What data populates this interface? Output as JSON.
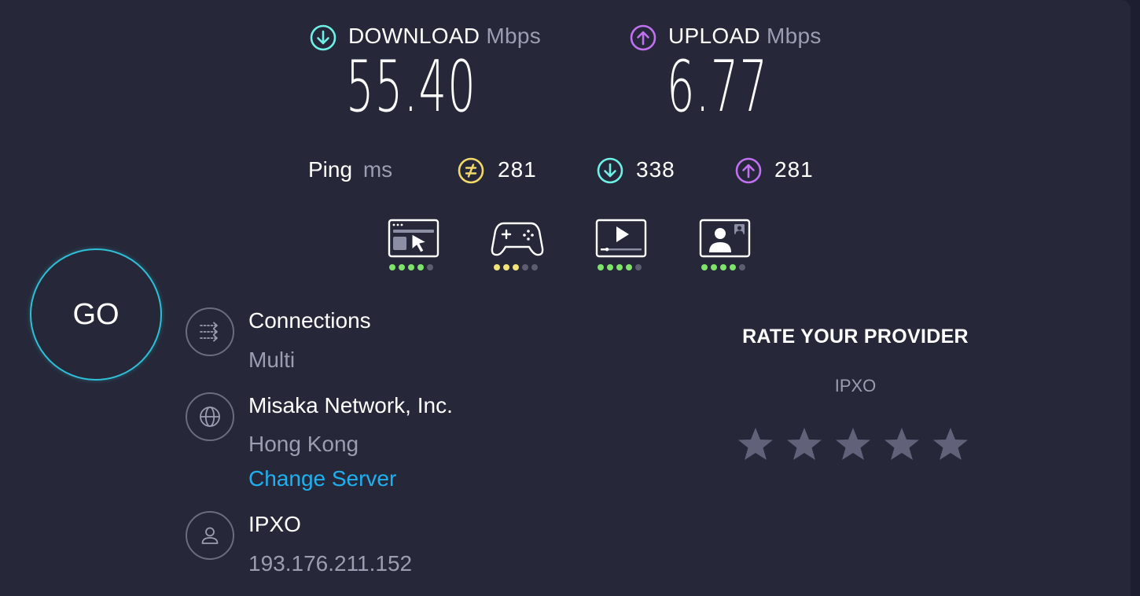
{
  "download": {
    "label": "DOWNLOAD",
    "unit": "Mbps",
    "value": "55.40",
    "icon": "arrow-down-circle-icon",
    "color": "#6ff0e6"
  },
  "upload": {
    "label": "UPLOAD",
    "unit": "Mbps",
    "value": "6.77",
    "icon": "arrow-up-circle-icon",
    "color": "#bf71f0"
  },
  "ping": {
    "label": "Ping",
    "unit": "ms",
    "idle": {
      "value": "281",
      "icon": "idle-ping-icon",
      "color": "#f2d96a"
    },
    "download": {
      "value": "338",
      "icon": "download-ping-icon",
      "color": "#6ff0e6"
    },
    "upload": {
      "value": "281",
      "icon": "upload-ping-icon",
      "color": "#bf71f0"
    }
  },
  "quality": [
    {
      "name": "browsing",
      "icon": "web-browsing-icon",
      "rating": 4,
      "max": 5,
      "color": "#7fe36b"
    },
    {
      "name": "gaming",
      "icon": "gamepad-icon",
      "rating": 3,
      "max": 5,
      "color": "#f2e27a"
    },
    {
      "name": "streaming",
      "icon": "video-streaming-icon",
      "rating": 4,
      "max": 5,
      "color": "#7fe36b"
    },
    {
      "name": "video-chat",
      "icon": "video-call-icon",
      "rating": 4,
      "max": 5,
      "color": "#7fe36b"
    }
  ],
  "go_label": "GO",
  "connections": {
    "title": "Connections",
    "value": "Multi",
    "icon": "connections-icon"
  },
  "server": {
    "name": "Misaka Network, Inc.",
    "location": "Hong Kong",
    "change_label": "Change Server",
    "icon": "globe-icon"
  },
  "provider": {
    "name": "IPXO",
    "ip": "193.176.211.152",
    "icon": "user-icon"
  },
  "rate": {
    "title": "RATE YOUR PROVIDER",
    "provider": "IPXO",
    "stars": 5,
    "star_color": "#61627a"
  },
  "colors": {
    "background": "#262839",
    "go_ring": "#2ec0d6",
    "link": "#1fb0ef",
    "muted": "#9b9db1",
    "dot_off": "#5c5e70"
  }
}
